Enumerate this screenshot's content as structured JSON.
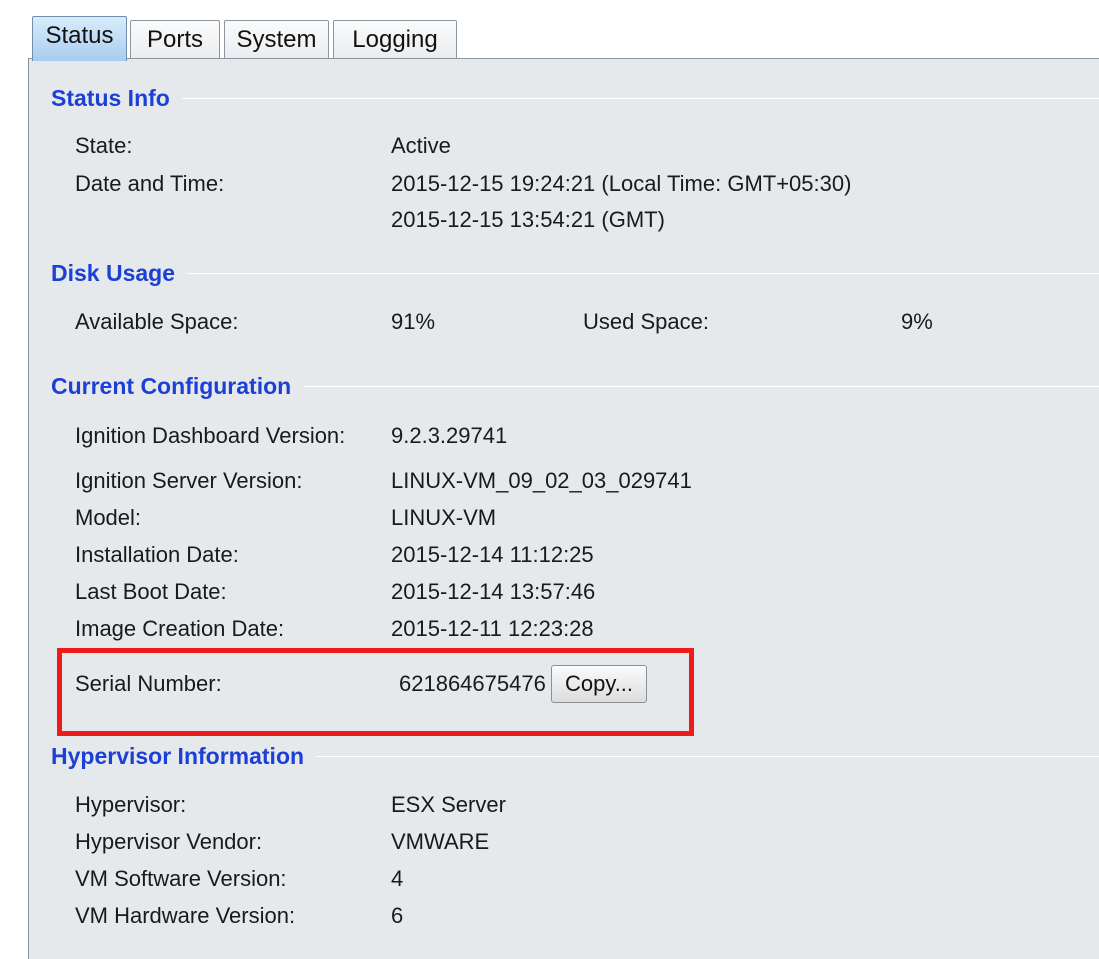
{
  "tabs": [
    {
      "label": "Status",
      "active": true
    },
    {
      "label": "Ports",
      "active": false
    },
    {
      "label": "System",
      "active": false
    },
    {
      "label": "Logging",
      "active": false
    }
  ],
  "status_info": {
    "title": "Status Info",
    "state_label": "State:",
    "state_value": "Active",
    "datetime_label": "Date and Time:",
    "datetime_local": "2015-12-15 19:24:21 (Local Time:  GMT+05:30)",
    "datetime_gmt": "2015-12-15 13:54:21 (GMT)"
  },
  "disk_usage": {
    "title": "Disk Usage",
    "available_label": "Available Space:",
    "available_value": "91%",
    "used_label": "Used Space:",
    "used_value": "9%"
  },
  "current_configuration": {
    "title": "Current Configuration",
    "rows": [
      {
        "label": "Ignition Dashboard Version:",
        "value": "9.2.3.29741"
      },
      {
        "label": "Ignition Server Version:",
        "value": "LINUX-VM_09_02_03_029741"
      },
      {
        "label": "Model:",
        "value": "LINUX-VM"
      },
      {
        "label": "Installation Date:",
        "value": "2015-12-14 11:12:25"
      },
      {
        "label": "Last Boot Date:",
        "value": "2015-12-14 13:57:46"
      },
      {
        "label": "Image Creation Date:",
        "value": "2015-12-11 12:23:28"
      }
    ],
    "serial_label": "Serial Number:",
    "serial_value": "621864675476",
    "copy_button": "Copy..."
  },
  "hypervisor_information": {
    "title": "Hypervisor Information",
    "rows": [
      {
        "label": "Hypervisor:",
        "value": "ESX Server"
      },
      {
        "label": "Hypervisor Vendor:",
        "value": "VMWARE"
      },
      {
        "label": "VM Software Version:",
        "value": "4"
      },
      {
        "label": "VM Hardware Version:",
        "value": "6"
      }
    ]
  },
  "colors": {
    "section_title": "#1c3fd6",
    "panel_background": "#e6e9ec",
    "highlight_border": "#ef1b1b"
  }
}
